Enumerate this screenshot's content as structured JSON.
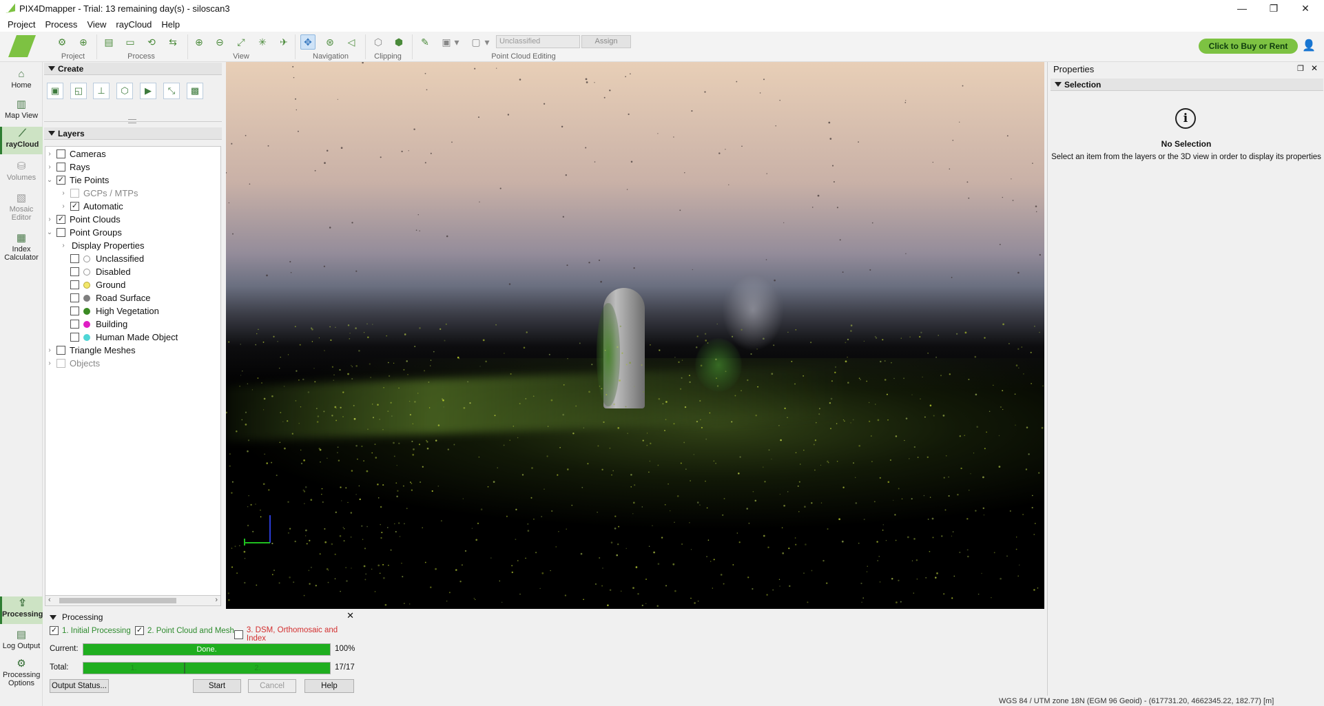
{
  "window": {
    "title": "PIX4Dmapper - Trial: 13 remaining day(s) - siloscan3",
    "minimize_glyph": "—",
    "restore_glyph": "❐",
    "close_glyph": "✕"
  },
  "menu": [
    "Project",
    "Process",
    "View",
    "rayCloud",
    "Help"
  ],
  "ribbon": {
    "groups": [
      "Project",
      "Process",
      "View",
      "Navigation",
      "Clipping",
      "Point Cloud Editing"
    ],
    "class_select_value": "Unclassified",
    "assign_label": "Assign",
    "buy_label": "Click to Buy or Rent"
  },
  "leftnav": {
    "items": [
      "Home",
      "Map View",
      "rayCloud",
      "Volumes",
      "Mosaic Editor",
      "Index Calculator"
    ],
    "lower": [
      "Processing",
      "Log Output",
      "Processing Options"
    ]
  },
  "create": {
    "title": "Create"
  },
  "layers": {
    "title": "Layers",
    "rows": [
      {
        "label": "Cameras",
        "checked": false
      },
      {
        "label": "Rays",
        "checked": false
      },
      {
        "label": "Tie Points",
        "checked": true
      },
      {
        "label": "GCPs / MTPs",
        "checked": false
      },
      {
        "label": "Automatic",
        "checked": true
      },
      {
        "label": "Point Clouds",
        "checked": true
      },
      {
        "label": "Point Groups",
        "checked": false
      },
      {
        "label": "Display Properties"
      },
      {
        "label": "Unclassified",
        "color": "#ffffff"
      },
      {
        "label": "Disabled",
        "color": "#ffffff"
      },
      {
        "label": "Ground",
        "color": "#f2e76a"
      },
      {
        "label": "Road Surface",
        "color": "#7f7f7f"
      },
      {
        "label": "High Vegetation",
        "color": "#3a8a23"
      },
      {
        "label": "Building",
        "color": "#e01ec4"
      },
      {
        "label": "Human Made Object",
        "color": "#4fd6d6"
      },
      {
        "label": "Triangle Meshes",
        "checked": false
      },
      {
        "label": "Objects",
        "checked": false
      }
    ]
  },
  "properties": {
    "title": "Properties",
    "section": "Selection",
    "no_selection": "No Selection",
    "hint": "Select an item from the layers or the 3D view in order to display its properties"
  },
  "processing": {
    "title": "Processing",
    "steps": [
      {
        "label": "1. Initial Processing",
        "checked": true
      },
      {
        "label": "2. Point Cloud and Mesh",
        "checked": true
      },
      {
        "label": "3. DSM, Orthomosaic and Index",
        "checked": false
      }
    ],
    "current_label": "Current:",
    "current_text": "Done.",
    "current_value": "100%",
    "current_progress": 1.0,
    "total_label": "Total:",
    "total_seg1": "1.",
    "total_seg2": "2.",
    "total_value": "17/17",
    "output_status": "Output Status...",
    "start": "Start",
    "cancel": "Cancel",
    "help": "Help"
  },
  "statusbar": "WGS 84 / UTM zone 18N (EGM 96 Geoid) - (617731.20, 4662345.22, 182.77) [m]"
}
